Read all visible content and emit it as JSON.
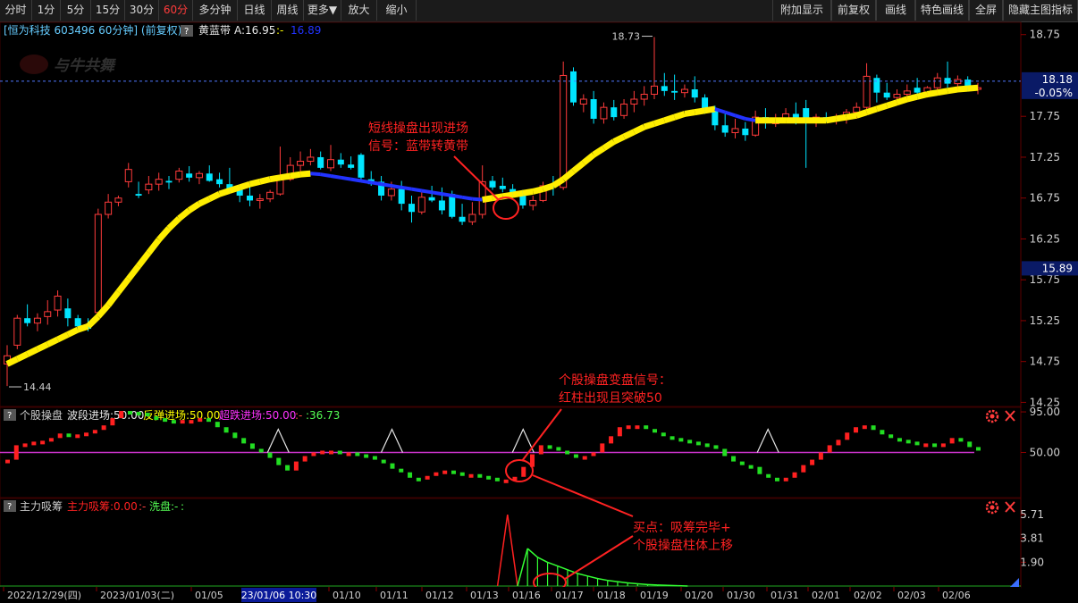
{
  "toolbar": {
    "left": [
      {
        "label": "分时"
      },
      {
        "label": "1分"
      },
      {
        "label": "5分"
      },
      {
        "label": "15分"
      },
      {
        "label": "30分"
      },
      {
        "label": "60分",
        "active": true
      },
      {
        "label": "多分钟"
      },
      {
        "label": "日线"
      },
      {
        "label": "周线"
      },
      {
        "label": "更多▼"
      },
      {
        "label": "放大"
      },
      {
        "label": "缩小"
      }
    ],
    "right": [
      {
        "label": "附加显示"
      },
      {
        "label": "前复权"
      },
      {
        "label": "画线"
      },
      {
        "label": "特色画线"
      },
      {
        "label": "全屏"
      },
      {
        "label": "隐藏主图指标"
      }
    ]
  },
  "main_header": {
    "stock_title": "[恒为科技 603496 60分钟] (前复权)",
    "help_badge": "?",
    "indicator_name": "黄蓝带",
    "indicator_value": "A:16.95",
    "indicator_value2": ":-",
    "indicator_value3": "16.89"
  },
  "watermark": "与牛共舞",
  "annotations": {
    "signal1_line1": "短线操盘出现进场",
    "signal1_line2": "信号：蓝带转黄带",
    "signal2_line1": "个股操盘变盘信号：",
    "signal2_line2": "红柱出现且突破50",
    "signal3_line1": "买点：吸筹完毕+",
    "signal3_line2": "个股操盘柱体上移"
  },
  "panel2_header": {
    "help_badge": "?",
    "name": "个股操盘",
    "f1": "波段进场:50.00",
    "f2": "反弹进场:50.00",
    "f3": "超跌进场:50.00",
    "f4": ":-",
    "f5": ":36.73"
  },
  "panel3_header": {
    "help_badge": "?",
    "name": "主力吸筹",
    "f1": "主力吸筹:0.00",
    "f2": ":-",
    "f3": "洗盘:-",
    "f4": ":"
  },
  "price_axis": {
    "ticks": [
      "18.75",
      "17.75",
      "17.25",
      "16.75",
      "16.25",
      "15.75",
      "15.25",
      "14.75",
      "14.25"
    ],
    "current_price": "18.18",
    "current_change": "-0.05%",
    "marker_price": "15.89",
    "max_label": "18.73",
    "min_label": "14.44"
  },
  "panel2_axis": {
    "ticks": [
      "95.00",
      "50.00"
    ]
  },
  "panel3_axis": {
    "ticks": [
      "5.71",
      "3.81",
      "1.90"
    ]
  },
  "date_axis": {
    "labels": [
      "2022/12/29(四)",
      "2023/01/03(二)",
      "01/05",
      "01/10",
      "01/11",
      "01/12",
      "01/13",
      "01/16",
      "01/17",
      "01/18",
      "01/19",
      "01/20",
      "01/30",
      "01/31",
      "02/01",
      "02/02",
      "02/03",
      "02/06"
    ],
    "cursor_label": "23/01/06 10:30"
  },
  "chart_data": [
    {
      "type": "candlestick",
      "title": "[恒为科技 603496 60分钟] (前复权)",
      "interval": "60分钟",
      "ylim": [
        14.2,
        18.9
      ],
      "note": "approximate OHLC per 60-min bar, read off the axis",
      "ohlc": [
        [
          14.72,
          14.95,
          14.45,
          14.82
        ],
        [
          14.95,
          15.32,
          14.9,
          15.28
        ],
        [
          15.28,
          15.45,
          15.18,
          15.22
        ],
        [
          15.22,
          15.34,
          15.12,
          15.28
        ],
        [
          15.3,
          15.5,
          15.2,
          15.36
        ],
        [
          15.38,
          15.62,
          15.3,
          15.55
        ],
        [
          15.4,
          15.52,
          15.18,
          15.28
        ],
        [
          15.28,
          15.32,
          15.15,
          15.18
        ],
        [
          15.2,
          15.28,
          15.12,
          15.15
        ],
        [
          15.35,
          16.62,
          15.32,
          16.55
        ],
        [
          16.55,
          16.8,
          16.5,
          16.7
        ],
        [
          16.7,
          16.78,
          16.65,
          16.75
        ],
        [
          16.95,
          17.18,
          16.88,
          17.1
        ],
        [
          16.8,
          16.95,
          16.75,
          16.78
        ],
        [
          16.85,
          17.02,
          16.8,
          16.92
        ],
        [
          16.92,
          17.06,
          16.84,
          16.98
        ],
        [
          16.96,
          17.02,
          16.86,
          16.94
        ],
        [
          16.98,
          17.12,
          16.94,
          17.08
        ],
        [
          17.05,
          17.14,
          16.95,
          17.0
        ],
        [
          17.0,
          17.08,
          16.92,
          17.05
        ],
        [
          17.05,
          17.15,
          16.95,
          16.96
        ],
        [
          16.98,
          17.06,
          16.88,
          16.92
        ],
        [
          16.92,
          17.12,
          16.8,
          16.85
        ],
        [
          16.85,
          16.9,
          16.7,
          16.78
        ],
        [
          16.78,
          16.9,
          16.65,
          16.72
        ],
        [
          16.72,
          16.8,
          16.62,
          16.74
        ],
        [
          16.74,
          16.85,
          16.7,
          16.82
        ],
        [
          16.8,
          17.38,
          16.78,
          16.98
        ],
        [
          16.98,
          17.25,
          16.96,
          17.15
        ],
        [
          17.15,
          17.32,
          17.05,
          17.2
        ],
        [
          17.2,
          17.35,
          17.15,
          17.25
        ],
        [
          17.25,
          17.32,
          17.1,
          17.12
        ],
        [
          17.12,
          17.4,
          17.08,
          17.22
        ],
        [
          17.22,
          17.3,
          17.12,
          17.16
        ],
        [
          17.16,
          17.26,
          17.1,
          17.12
        ],
        [
          17.28,
          17.3,
          16.95,
          17.0
        ],
        [
          16.98,
          17.08,
          16.9,
          16.92
        ],
        [
          16.95,
          17.02,
          16.72,
          16.78
        ],
        [
          16.78,
          16.95,
          16.72,
          16.86
        ],
        [
          16.86,
          16.96,
          16.6,
          16.68
        ],
        [
          16.68,
          16.78,
          16.45,
          16.58
        ],
        [
          16.58,
          16.82,
          16.55,
          16.76
        ],
        [
          16.76,
          16.9,
          16.7,
          16.72
        ],
        [
          16.72,
          16.88,
          16.55,
          16.6
        ],
        [
          16.8,
          16.84,
          16.5,
          16.52
        ],
        [
          16.52,
          16.68,
          16.42,
          16.46
        ],
        [
          16.46,
          16.7,
          16.42,
          16.55
        ],
        [
          16.55,
          17.15,
          16.5,
          16.95
        ],
        [
          16.96,
          17.02,
          16.85,
          16.88
        ],
        [
          16.9,
          17.0,
          16.82,
          16.86
        ],
        [
          16.86,
          16.92,
          16.75,
          16.8
        ],
        [
          16.8,
          16.85,
          16.62,
          16.66
        ],
        [
          16.66,
          16.78,
          16.6,
          16.72
        ],
        [
          16.72,
          16.95,
          16.7,
          16.9
        ],
        [
          16.9,
          17.02,
          16.78,
          16.88
        ],
        [
          16.88,
          18.42,
          16.85,
          18.25
        ],
        [
          18.3,
          18.35,
          17.88,
          17.92
        ],
        [
          17.9,
          18.02,
          17.8,
          17.96
        ],
        [
          17.96,
          18.06,
          17.66,
          17.72
        ],
        [
          17.72,
          17.92,
          17.66,
          17.86
        ],
        [
          17.86,
          17.95,
          17.7,
          17.74
        ],
        [
          17.76,
          17.96,
          17.72,
          17.9
        ],
        [
          17.9,
          18.06,
          17.8,
          17.96
        ],
        [
          17.96,
          18.12,
          17.88,
          18.02
        ],
        [
          18.02,
          18.72,
          17.96,
          18.12
        ],
        [
          18.12,
          18.28,
          18.0,
          18.06
        ],
        [
          18.06,
          18.26,
          17.95,
          18.04
        ],
        [
          18.04,
          18.14,
          17.98,
          18.08
        ],
        [
          18.08,
          18.24,
          17.92,
          17.98
        ],
        [
          17.98,
          18.02,
          17.78,
          17.82
        ],
        [
          17.82,
          17.88,
          17.58,
          17.64
        ],
        [
          17.64,
          17.78,
          17.5,
          17.55
        ],
        [
          17.55,
          17.72,
          17.48,
          17.6
        ],
        [
          17.6,
          17.68,
          17.45,
          17.52
        ],
        [
          17.52,
          17.82,
          17.5,
          17.74
        ],
        [
          17.74,
          17.85,
          17.6,
          17.68
        ],
        [
          17.66,
          17.78,
          17.62,
          17.72
        ],
        [
          17.72,
          17.85,
          17.7,
          17.78
        ],
        [
          17.78,
          17.92,
          17.65,
          17.68
        ],
        [
          17.85,
          17.95,
          17.12,
          17.7
        ],
        [
          17.68,
          17.78,
          17.62,
          17.74
        ],
        [
          17.74,
          17.8,
          17.68,
          17.7
        ],
        [
          17.7,
          17.78,
          17.65,
          17.72
        ],
        [
          17.72,
          17.84,
          17.66,
          17.8
        ],
        [
          17.8,
          17.92,
          17.72,
          17.86
        ],
        [
          17.86,
          18.4,
          17.82,
          18.24
        ],
        [
          18.22,
          18.26,
          17.92,
          18.04
        ],
        [
          18.04,
          18.16,
          17.95,
          17.98
        ],
        [
          17.98,
          18.08,
          17.92,
          18.02
        ],
        [
          18.02,
          18.14,
          17.94,
          18.06
        ],
        [
          18.1,
          18.22,
          18.0,
          18.04
        ],
        [
          18.04,
          18.12,
          17.98,
          18.1
        ],
        [
          18.1,
          18.28,
          18.02,
          18.22
        ],
        [
          18.22,
          18.42,
          18.1,
          18.15
        ],
        [
          18.15,
          18.25,
          18.05,
          18.2
        ],
        [
          18.2,
          18.24,
          18.06,
          18.08
        ],
        [
          18.08,
          18.16,
          18.02,
          18.1
        ]
      ]
    },
    {
      "type": "line",
      "name": "黄蓝带 A",
      "note": "yellow = rising band, blue = falling band; last value 16.95",
      "values": [
        14.72,
        14.78,
        14.84,
        14.9,
        14.96,
        15.02,
        15.08,
        15.14,
        15.18,
        15.3,
        15.44,
        15.6,
        15.76,
        15.92,
        16.08,
        16.24,
        16.38,
        16.5,
        16.6,
        16.68,
        16.74,
        16.8,
        16.84,
        16.88,
        16.92,
        16.95,
        16.98,
        17.0,
        17.02,
        17.04,
        17.05,
        17.04,
        17.02,
        17.0,
        16.98,
        16.96,
        16.94,
        16.92,
        16.9,
        16.88,
        16.86,
        16.84,
        16.82,
        16.8,
        16.78,
        16.76,
        16.74,
        16.73,
        16.75,
        16.77,
        16.79,
        16.81,
        16.83,
        16.86,
        16.9,
        16.98,
        17.08,
        17.18,
        17.28,
        17.36,
        17.44,
        17.5,
        17.56,
        17.62,
        17.66,
        17.7,
        17.74,
        17.78,
        17.8,
        17.82,
        17.84,
        17.8,
        17.76,
        17.72,
        17.7,
        17.7,
        17.7,
        17.7,
        17.7,
        17.7,
        17.7,
        17.7,
        17.72,
        17.74,
        17.76,
        17.8,
        17.84,
        17.88,
        17.92,
        17.96,
        17.99,
        18.02,
        18.04,
        18.06,
        18.08,
        18.09,
        18.1
      ]
    },
    {
      "type": "bar",
      "name": "个股操盘",
      "ylim": [
        0,
        100
      ],
      "reference_lines": [
        50,
        95
      ],
      "note": "approximate values; red = rising bar, green = falling bar, white triangles at reversal points",
      "values": [
        42,
        58,
        60,
        62,
        63,
        66,
        71,
        70,
        70,
        72,
        75,
        80,
        88,
        96,
        95,
        94,
        90,
        88,
        86,
        84,
        86,
        86,
        88,
        84,
        78,
        72,
        66,
        60,
        54,
        50,
        44,
        36,
        30,
        40,
        46,
        50,
        52,
        52,
        50,
        50,
        48,
        46,
        42,
        38,
        32,
        28,
        22,
        20,
        24,
        28,
        30,
        28,
        26,
        26,
        24,
        22,
        20,
        20,
        23,
        34,
        48,
        58,
        56,
        52,
        48,
        46,
        46,
        50,
        60,
        68,
        78,
        80,
        80,
        76,
        72,
        68,
        66,
        64,
        62,
        60,
        58,
        54,
        46,
        40,
        36,
        34,
        26,
        22,
        20,
        22,
        28,
        36,
        42,
        50,
        58,
        64,
        72,
        78,
        80,
        75,
        70,
        66,
        64,
        62,
        60,
        60,
        58,
        60,
        66,
        62,
        56,
        54
      ],
      "triangles_at_index": [
        31,
        44,
        59,
        87
      ]
    },
    {
      "type": "line",
      "name": "主力吸筹",
      "ylim": [
        0,
        6.0
      ],
      "note": "red spike then green decaying spikes before 01/16",
      "values": [
        0,
        0,
        0,
        0,
        0,
        0,
        0,
        0,
        0,
        0,
        0,
        0,
        0,
        0,
        0,
        0,
        0,
        0,
        0,
        0,
        0,
        0,
        0,
        0,
        0,
        0,
        0,
        0,
        0,
        0,
        0,
        0,
        0,
        0,
        0,
        0,
        0,
        0,
        0,
        0,
        0,
        0,
        0,
        0,
        0,
        0,
        0,
        0,
        0,
        0,
        5.71,
        0,
        3.0,
        2.3,
        1.9,
        1.6,
        1.3,
        1.0,
        0.8,
        0.6,
        0.45,
        0.35,
        0.25,
        0.18,
        0.12,
        0.08,
        0.05,
        0.03,
        0,
        0,
        0,
        0,
        0,
        0,
        0,
        0,
        0,
        0,
        0,
        0,
        0,
        0,
        0,
        0,
        0,
        0,
        0,
        0,
        0,
        0,
        0,
        0,
        0,
        0,
        0,
        0,
        0,
        0
      ]
    }
  ]
}
